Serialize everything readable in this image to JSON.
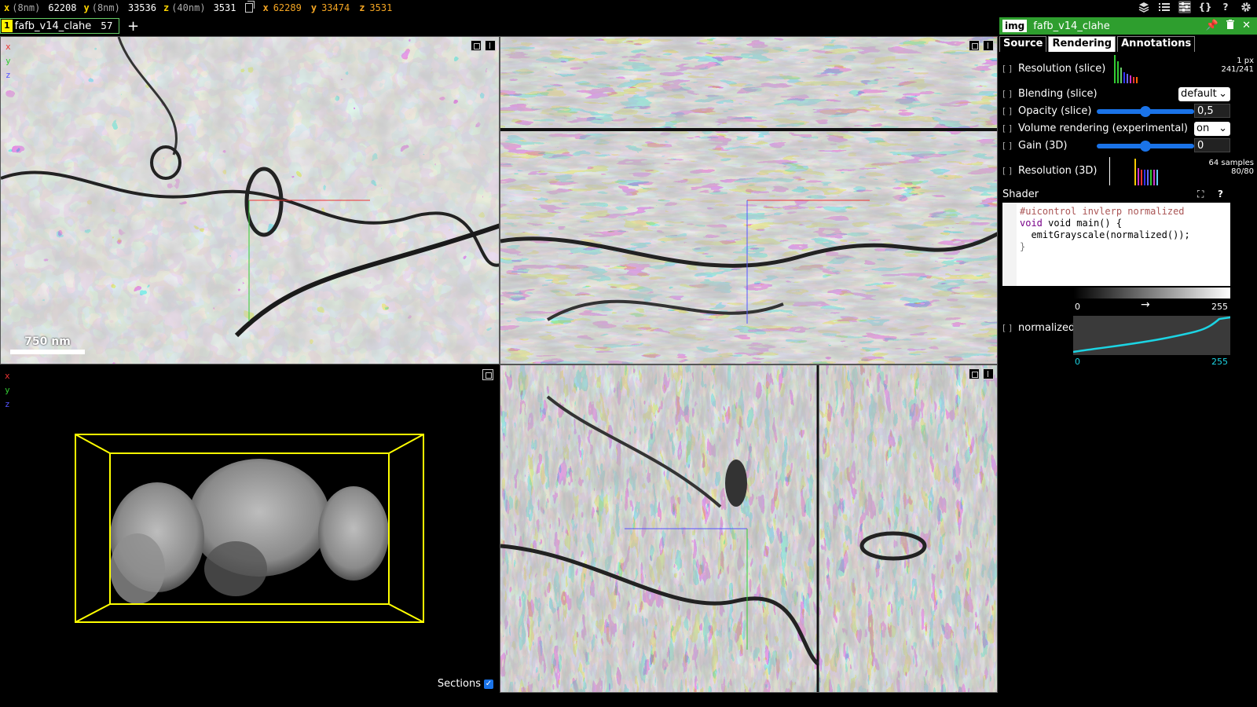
{
  "topbar": {
    "x_label": "x",
    "x_unit": "(8nm)",
    "x_value": "62208",
    "y_label": "y",
    "y_unit": "(8nm)",
    "y_value": "33536",
    "z_label": "z",
    "z_unit": "(40nm)",
    "z_value": "3531",
    "mouse_x_label": "x",
    "mouse_x_value": "62289",
    "mouse_y_label": "y",
    "mouse_y_value": "33474",
    "mouse_z_label": "z",
    "mouse_z_value": "3531",
    "icons": [
      "layers-icon",
      "list-icon",
      "sliders-icon",
      "json-icon",
      "help-icon",
      "settings-icon"
    ]
  },
  "layerbar": {
    "layer_number": "1",
    "layer_name": "fafb_v14_clahe",
    "layer_count": "57",
    "add_label": "+"
  },
  "panels": {
    "axis_x": "x",
    "axis_y": "y",
    "axis_z": "z",
    "scalebar_label": "750 nm",
    "sections_label": "Sections"
  },
  "side": {
    "type_badge": "img",
    "layer_name": "fafb_v14_clahe",
    "tabs": [
      {
        "label": "Source"
      },
      {
        "label": "Rendering"
      },
      {
        "label": "Annotations"
      }
    ],
    "resolution_slice_label": "Resolution (slice)",
    "resolution_slice_px": "1 px",
    "resolution_slice_count": "241/241",
    "blending_label": "Blending (slice)",
    "blending_value": "default",
    "opacity_label": "Opacity (slice)",
    "opacity_value": "0,5",
    "opacity_fraction": 0.5,
    "volume_label": "Volume rendering (experimental)",
    "volume_value": "on",
    "gain_label": "Gain (3D)",
    "gain_value": "0",
    "gain_fraction": 0.5,
    "resolution3d_label": "Resolution (3D)",
    "resolution3d_samples": "64 samples",
    "resolution3d_count": "80/80",
    "shader_label": "Shader",
    "shader_code": [
      "#uicontrol invlerp normalized",
      "void main() {",
      "  emitGrayscale(normalized());",
      "}"
    ],
    "range_min": "0",
    "range_max": "255",
    "normalized_label": "normalized",
    "curve_min": "0",
    "curve_max": "255"
  }
}
